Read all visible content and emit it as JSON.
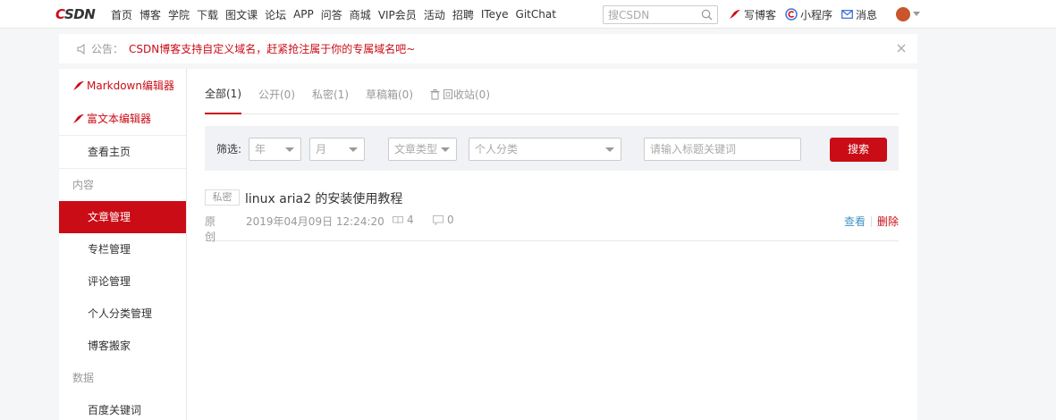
{
  "header": {
    "logo": {
      "c": "C",
      "rest": "SDN"
    },
    "nav": [
      "首页",
      "博客",
      "学院",
      "下载",
      "图文课",
      "论坛",
      "APP",
      "问答",
      "商城",
      "VIP会员",
      "活动",
      "招聘",
      "ITeye",
      "GitChat"
    ],
    "search_placeholder": "搜CSDN",
    "write_blog": "写博客",
    "mini_program": "小程序",
    "messages": "消息"
  },
  "notice": {
    "label": "公告：",
    "text": "CSDN博客支持自定义域名，赶紧抢注属于你的专属域名吧~"
  },
  "sidebar": {
    "markdown_editor": "Markdown编辑器",
    "richtext_editor": "富文本编辑器",
    "view_home": "查看主页",
    "group_content": "内容",
    "items": [
      "文章管理",
      "专栏管理",
      "评论管理",
      "个人分类管理",
      "博客搬家"
    ],
    "group_data": "数据",
    "data_items": [
      "百度关键词"
    ]
  },
  "tabs": [
    {
      "label": "全部(1)",
      "active": true
    },
    {
      "label": "公开(0)"
    },
    {
      "label": "私密(1)"
    },
    {
      "label": "草稿箱(0)"
    },
    {
      "label": "回收站(0)"
    }
  ],
  "filter": {
    "label": "筛选:",
    "year": "年",
    "month": "月",
    "article_type": "文章类型",
    "category": "个人分类",
    "keyword_placeholder": "请输入标题关键词",
    "search_button": "搜索"
  },
  "article": {
    "tag": "私密",
    "title": "linux aria2 的安装使用教程",
    "type": "原创",
    "date": "2019年04月09日 12:24:20",
    "views": "4",
    "comments": "0",
    "view_action": "查看",
    "delete_action": "删除"
  },
  "colors": {
    "brand": "#ca0c16",
    "link": "#4093c6"
  }
}
